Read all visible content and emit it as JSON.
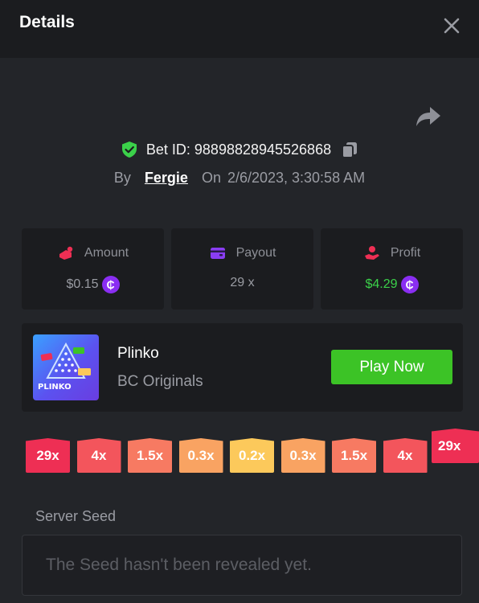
{
  "header": {
    "title": "Details"
  },
  "bet": {
    "id_label": "Bet ID: 98898828945526868",
    "by_label": "By",
    "user": "Fergie",
    "on_label": "On",
    "datetime": "2/6/2023, 3:30:58 AM"
  },
  "stats": {
    "amount_label": "Amount",
    "amount_value": "$0.15",
    "payout_label": "Payout",
    "payout_value": "29 x",
    "profit_label": "Profit",
    "profit_value": "$4.29",
    "coin_symbol": "₵"
  },
  "game": {
    "name": "Plinko",
    "provider": "BC Originals",
    "thumb_text": "PLINKO",
    "play_label": "Play Now"
  },
  "buckets": [
    {
      "label": "29x",
      "color": "#ee2f54"
    },
    {
      "label": "4x",
      "color": "#f3555c"
    },
    {
      "label": "1.5x",
      "color": "#f77a62"
    },
    {
      "label": "0.3x",
      "color": "#f9a362"
    },
    {
      "label": "0.2x",
      "color": "#fcc95b"
    },
    {
      "label": "0.3x",
      "color": "#f9a362"
    },
    {
      "label": "1.5x",
      "color": "#f77a62"
    },
    {
      "label": "4x",
      "color": "#f3555c"
    },
    {
      "label": "29x",
      "color": "#ee2f54"
    }
  ],
  "seed": {
    "label": "Server Seed",
    "placeholder": "The Seed hasn't been revealed yet."
  },
  "colors": {
    "accent_green": "#3cc326",
    "profit_green": "#3bd14a",
    "coin_purple": "#8a2ef2"
  }
}
